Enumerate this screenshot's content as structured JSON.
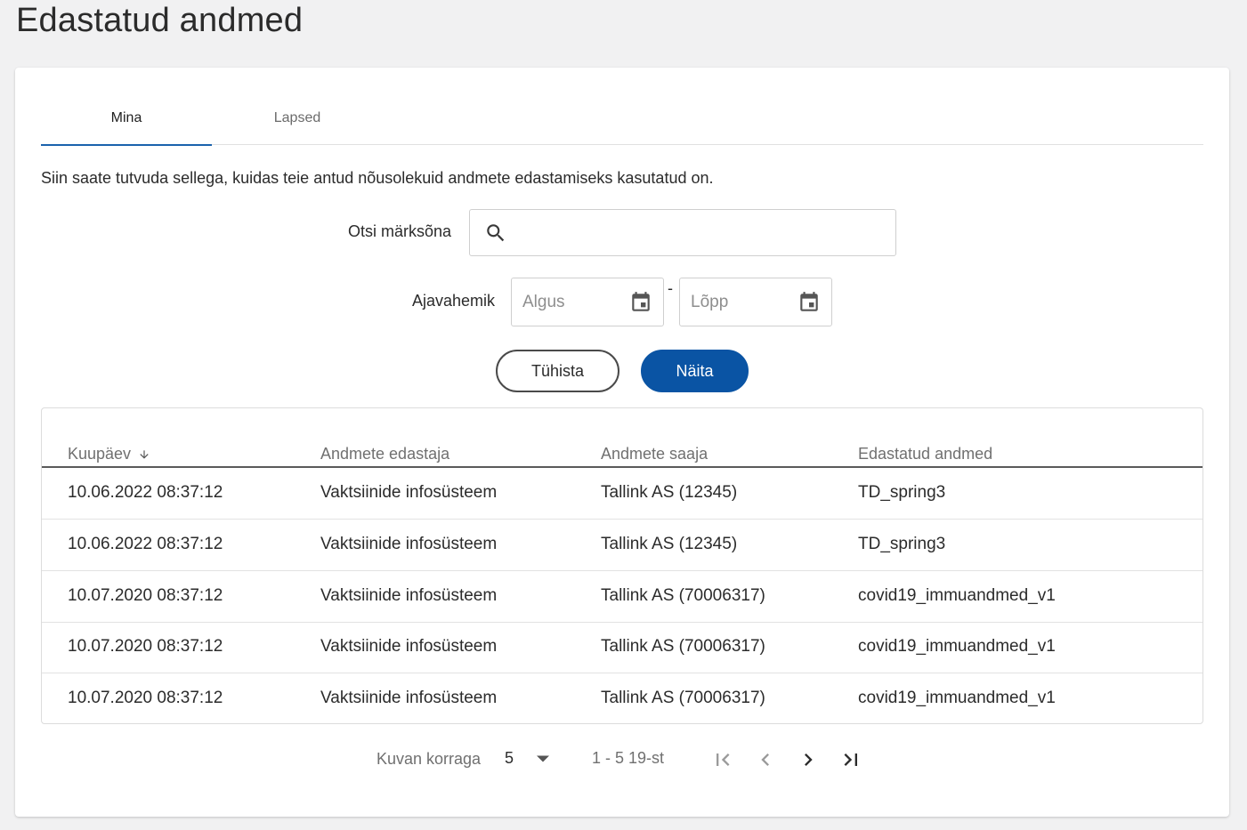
{
  "page": {
    "title": "Edastatud andmed"
  },
  "tabs": [
    {
      "label": "Mina",
      "active": true
    },
    {
      "label": "Lapsed",
      "active": false
    }
  ],
  "intro_text": "Siin saate tutvuda sellega, kuidas teie antud nõusolekuid andmete edastamiseks kasutatud on.",
  "search": {
    "label": "Otsi märksõna",
    "value": "",
    "placeholder": ""
  },
  "date_range": {
    "label": "Ajavahemik",
    "start_placeholder": "Algus",
    "separator": "-",
    "end_placeholder": "Lõpp"
  },
  "buttons": {
    "cancel_label": "Tühista",
    "show_label": "Näita"
  },
  "colors": {
    "accent": "#0a54a4",
    "tab_indicator": "#1a62ad"
  },
  "table": {
    "columns": [
      "Kuupäev",
      "Andmete edastaja",
      "Andmete saaja",
      "Edastatud andmed"
    ],
    "sort_column": "Kuupäev",
    "sort_direction": "desc",
    "rows": [
      [
        "10.06.2022 08:37:12",
        "Vaktsiinide infosüsteem",
        "Tallink AS (12345)",
        "TD_spring3"
      ],
      [
        "10.06.2022 08:37:12",
        "Vaktsiinide infosüsteem",
        "Tallink AS (12345)",
        "TD_spring3"
      ],
      [
        "10.07.2020 08:37:12",
        "Vaktsiinide infosüsteem",
        "Tallink AS (70006317)",
        "covid19_immuandmed_v1"
      ],
      [
        "10.07.2020 08:37:12",
        "Vaktsiinide infosüsteem",
        "Tallink AS (70006317)",
        "covid19_immuandmed_v1"
      ],
      [
        "10.07.2020 08:37:12",
        "Vaktsiinide infosüsteem",
        "Tallink AS (70006317)",
        "covid19_immuandmed_v1"
      ]
    ]
  },
  "paginator": {
    "page_size_label": "Kuvan korraga",
    "page_size": "5",
    "range_label": "1 - 5 19-st",
    "icons": [
      "first-page-icon",
      "previous-page-icon",
      "next-page-icon",
      "last-page-icon"
    ]
  }
}
